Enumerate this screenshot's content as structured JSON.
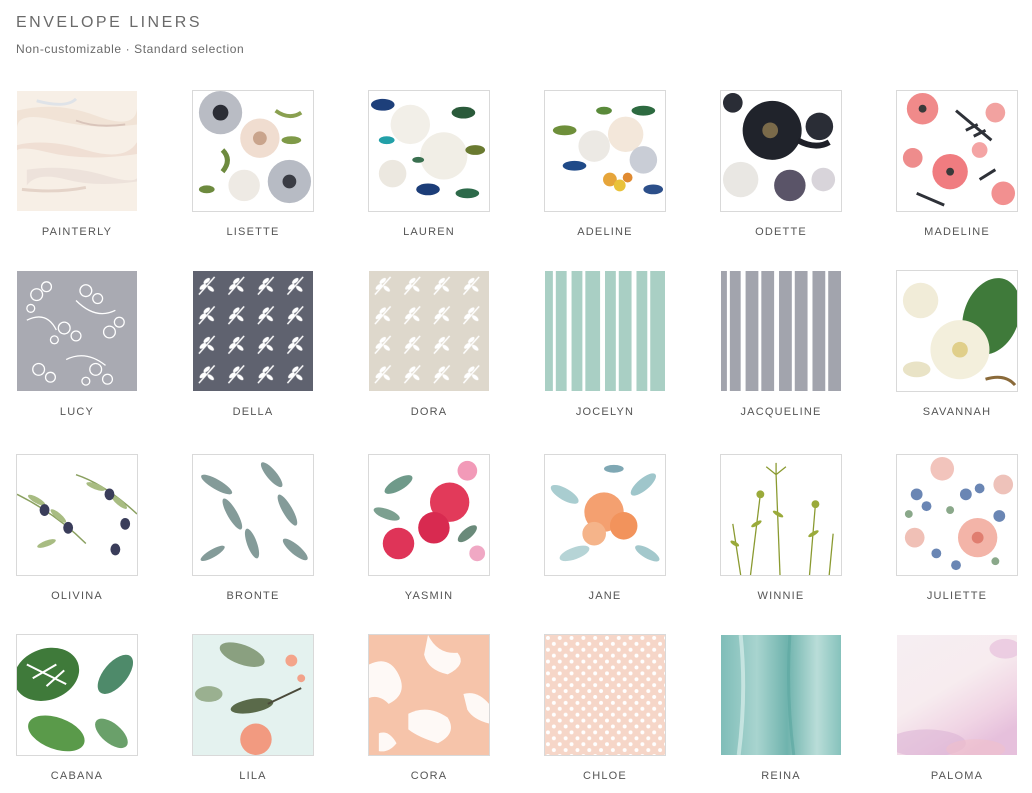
{
  "header": {
    "title": "ENVELOPE LINERS",
    "subtitle": "Non-customizable · Standard selection"
  },
  "liners": [
    {
      "label": "PAINTERLY",
      "pattern": "painterly"
    },
    {
      "label": "LISETTE",
      "pattern": "lisette"
    },
    {
      "label": "LAUREN",
      "pattern": "lauren"
    },
    {
      "label": "ADELINE",
      "pattern": "adeline"
    },
    {
      "label": "ODETTE",
      "pattern": "odette"
    },
    {
      "label": "MADELINE",
      "pattern": "madeline"
    },
    {
      "label": "LUCY",
      "pattern": "lucy"
    },
    {
      "label": "DELLA",
      "pattern": "della"
    },
    {
      "label": "DORA",
      "pattern": "dora"
    },
    {
      "label": "JOCELYN",
      "pattern": "jocelyn"
    },
    {
      "label": "JACQUELINE",
      "pattern": "jacqueline"
    },
    {
      "label": "SAVANNAH",
      "pattern": "savannah"
    },
    {
      "label": "OLIVINA",
      "pattern": "olivina"
    },
    {
      "label": "BRONTE",
      "pattern": "bronte"
    },
    {
      "label": "YASMIN",
      "pattern": "yasmin"
    },
    {
      "label": "JANE",
      "pattern": "jane"
    },
    {
      "label": "WINNIE",
      "pattern": "winnie"
    },
    {
      "label": "JULIETTE",
      "pattern": "juliette"
    },
    {
      "label": "CABANA",
      "pattern": "cabana"
    },
    {
      "label": "LILA",
      "pattern": "lila"
    },
    {
      "label": "CORA",
      "pattern": "cora"
    },
    {
      "label": "CHLOE",
      "pattern": "chloe"
    },
    {
      "label": "REINA",
      "pattern": "reina"
    },
    {
      "label": "PALOMA",
      "pattern": "paloma"
    }
  ]
}
